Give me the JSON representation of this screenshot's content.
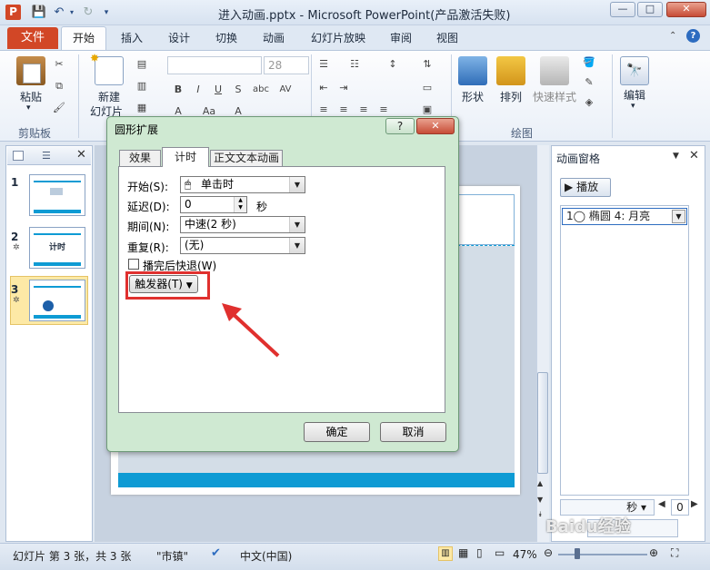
{
  "window": {
    "title": "进入动画.pptx - Microsoft PowerPoint(产品激活失败)",
    "app_icon": "P",
    "minimize": "—",
    "maximize": "□",
    "close": "✕"
  },
  "tabs": [
    "文件",
    "开始",
    "插入",
    "设计",
    "切换",
    "动画",
    "幻灯片放映",
    "审阅",
    "视图"
  ],
  "ribbon": {
    "paste": "粘贴",
    "clipboard_group": "剪贴板",
    "new_slide_line1": "新建",
    "new_slide_line2": "幻灯片",
    "font_size": "28",
    "shape": "形状",
    "arrange": "排列",
    "quick_style": "快速样式",
    "drawing_group": "绘图",
    "edit": "编辑"
  },
  "slide_pane": {
    "thumbs": [
      {
        "num": "1",
        "text": ""
      },
      {
        "num": "2",
        "text": "计时"
      },
      {
        "num": "3",
        "text": ""
      }
    ]
  },
  "anim_pane": {
    "title": "动画窗格",
    "play": "播放",
    "item": "1◯  椭圆 4: 月亮",
    "seconds": "秒",
    "zero": "0"
  },
  "dialog": {
    "title": "圆形扩展",
    "help": "?",
    "tabs": [
      "效果",
      "计时",
      "正文文本动画"
    ],
    "start_label": "开始(S):",
    "start_value": "单击时",
    "delay_label": "延迟(D):",
    "delay_value": "0",
    "delay_unit": "秒",
    "period_label": "期间(N):",
    "period_value": "中速(2 秒)",
    "repeat_label": "重复(R):",
    "repeat_value": "(无)",
    "rewind_label": "播完后快退(W)",
    "trigger_label": "触发器(T)",
    "ok": "确定",
    "cancel": "取消"
  },
  "statusbar": {
    "slide_info": "幻灯片 第 3 张，共 3 张",
    "theme": "\"市镇\"",
    "language": "中文(中国)",
    "zoom": "47%"
  },
  "watermark": "Baidu经验",
  "colors": {
    "file_tab": "#d24726",
    "accent_blue": "#0e9bd4",
    "highlight_red": "#e0302e",
    "dialog_frame": "#cfe9d2"
  }
}
